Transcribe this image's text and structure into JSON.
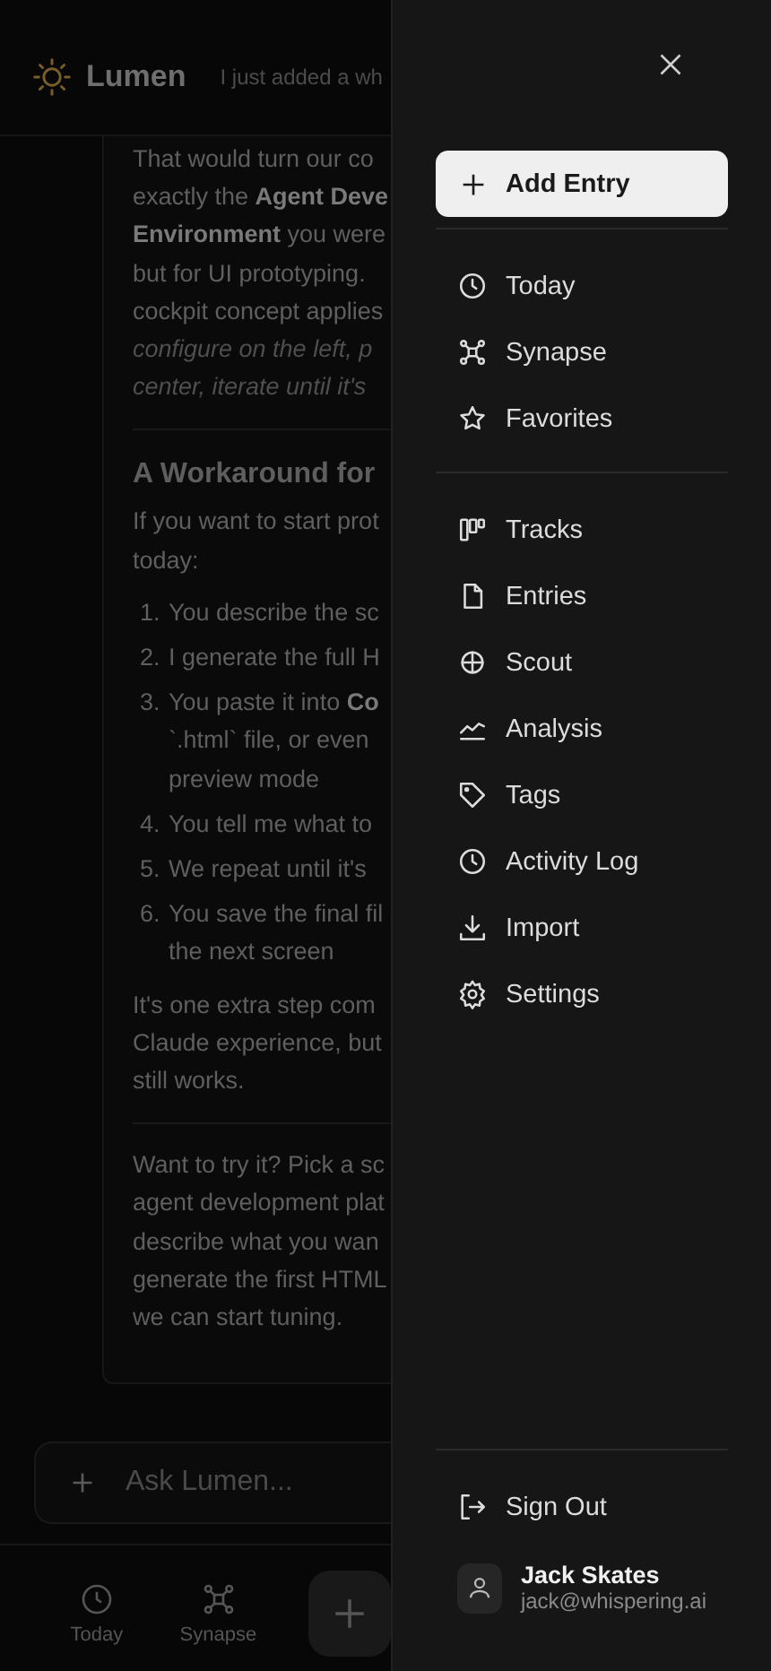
{
  "header": {
    "app_name": "Lumen",
    "title": "I just added a wh"
  },
  "message": {
    "blocks": [
      {
        "kind": "paragraph",
        "lines": [
          {
            "text": "That would turn our co",
            "italic": false
          },
          {
            "text": "exactly the **Agent Deve**",
            "italic": false
          },
          {
            "text": "**Environment** you were",
            "italic": false
          },
          {
            "text": "but for UI prototyping.",
            "italic": false
          },
          {
            "text": "cockpit concept applies",
            "italic": false
          },
          {
            "text": "configure on the left, p",
            "italic": true
          },
          {
            "text": "center, iterate until it's",
            "italic": true
          }
        ]
      },
      {
        "kind": "divider"
      },
      {
        "kind": "heading",
        "text": "A Workaround for"
      },
      {
        "kind": "paragraph",
        "lines": [
          {
            "text": "If you want to start prot",
            "italic": false
          },
          {
            "text": "today:",
            "italic": false
          }
        ]
      },
      {
        "kind": "list",
        "items": [
          {
            "number": "1.",
            "lines": [
              "You describe the sc"
            ]
          },
          {
            "number": "2.",
            "lines": [
              "I generate the full H"
            ]
          },
          {
            "number": "3.",
            "lines": [
              "You paste it into **Co**",
              "`.html` file, or even",
              "preview mode"
            ]
          },
          {
            "number": "4.",
            "lines": [
              "You tell me what to"
            ]
          },
          {
            "number": "5.",
            "lines": [
              "We repeat until it's"
            ]
          },
          {
            "number": "6.",
            "lines": [
              "You save the final fil",
              "the next screen"
            ]
          }
        ]
      },
      {
        "kind": "paragraph",
        "lines": [
          {
            "text": "It's one extra step com",
            "italic": false
          },
          {
            "text": "Claude experience, but",
            "italic": false
          },
          {
            "text": "still works.",
            "italic": false
          }
        ]
      },
      {
        "kind": "divider"
      },
      {
        "kind": "paragraph",
        "lines": [
          {
            "text": "Want to try it? Pick a sc",
            "italic": false
          },
          {
            "text": "agent development plat",
            "italic": false
          },
          {
            "text": "describe what you wan",
            "italic": false
          },
          {
            "text": "generate the first HTML",
            "italic": false
          },
          {
            "text": "we can start tuning.",
            "italic": false
          }
        ]
      }
    ]
  },
  "composer": {
    "placeholder": "Ask Lumen..."
  },
  "bottom_nav": [
    {
      "kind": "clock",
      "label": "Today"
    },
    {
      "kind": "network",
      "label": "Synapse"
    },
    {
      "kind": "add"
    }
  ],
  "drawer": {
    "primary_action": "Add Entry",
    "groups": [
      [
        {
          "kind": "clock",
          "label": "Today"
        },
        {
          "kind": "network",
          "label": "Synapse"
        },
        {
          "kind": "star",
          "label": "Favorites"
        }
      ],
      [
        {
          "kind": "board",
          "label": "Tracks"
        },
        {
          "kind": "file",
          "label": "Entries"
        },
        {
          "kind": "crosshair",
          "label": "Scout"
        },
        {
          "kind": "chart",
          "label": "Analysis"
        },
        {
          "kind": "tag",
          "label": "Tags"
        },
        {
          "kind": "clock",
          "label": "Activity Log"
        },
        {
          "kind": "download",
          "label": "Import"
        },
        {
          "kind": "gear",
          "label": "Settings"
        }
      ]
    ],
    "sign_out": "Sign Out",
    "user": {
      "name": "Jack Skates",
      "email": "jack@whispering.ai"
    }
  }
}
